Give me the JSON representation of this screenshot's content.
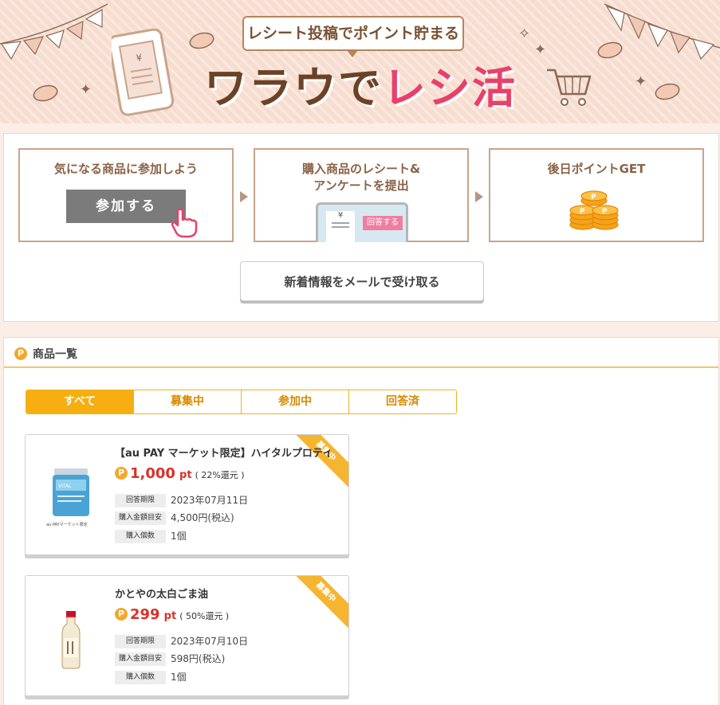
{
  "banner": {
    "tagline": "レシート投稿でポイント貯まる",
    "title_part1": "ワラウで",
    "title_part2": "レシ活"
  },
  "steps": [
    {
      "text": "気になる商品に参加しよう"
    },
    {
      "text": "購入商品のレシート&\nアンケートを提出"
    },
    {
      "text": "後日ポイントGET"
    }
  ],
  "step_demo": {
    "join_label": "参加する",
    "receipt_symbol": "¥",
    "answer_label": "回答する",
    "coin_letter": "P"
  },
  "subscribe_label": "新着情報をメールで受け取る",
  "product_list": {
    "title": "商品一覧",
    "badge": "P",
    "tabs": [
      {
        "label": "すべて",
        "active": true
      },
      {
        "label": "募集中",
        "active": false
      },
      {
        "label": "参加中",
        "active": false
      },
      {
        "label": "回答済",
        "active": false
      }
    ],
    "items": [
      {
        "status": "募集中",
        "title": "【au PAY マーケット限定】ハイタルプロテイン",
        "points": "1,000",
        "unit": "pt",
        "rate": "( 22%還元 )",
        "thumb_caption": "au PAYマーケット限定",
        "details": [
          {
            "label": "回答期限",
            "value": "2023年07月11日"
          },
          {
            "label": "購入金額目安",
            "value": "4,500円(税込)"
          },
          {
            "label": "購入個数",
            "value": "1個"
          }
        ]
      },
      {
        "status": "募集中",
        "title": "かとやの太白ごま油",
        "points": "299",
        "unit": "pt",
        "rate": "( 50%還元 )",
        "details": [
          {
            "label": "回答期限",
            "value": "2023年07月10日"
          },
          {
            "label": "購入金額目安",
            "value": "598円(税込)"
          },
          {
            "label": "購入個数",
            "value": "1個"
          }
        ]
      }
    ]
  }
}
